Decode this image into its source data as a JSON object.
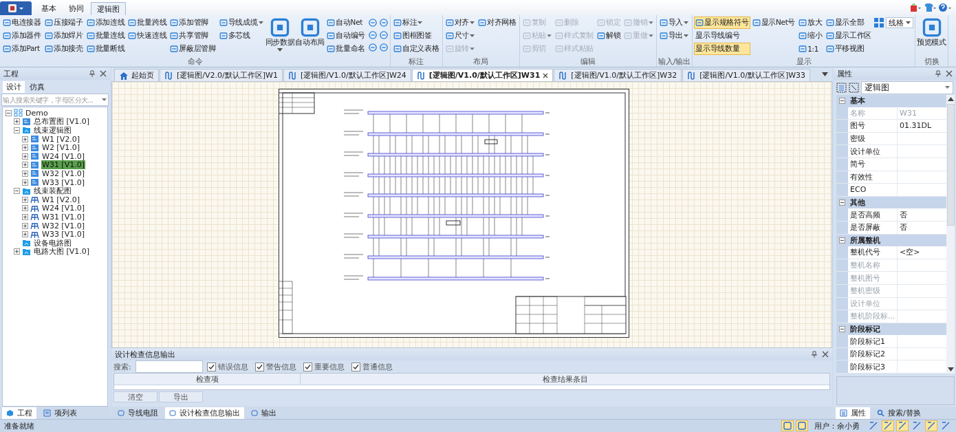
{
  "menu_tabs": [
    {
      "label": "基本",
      "selected": false
    },
    {
      "label": "协同",
      "selected": false
    },
    {
      "label": "逻辑图",
      "selected": true
    }
  ],
  "ribbon": [
    {
      "label": "命令",
      "columns": [
        {
          "kind": "small",
          "items": [
            {
              "label": "电连接器",
              "disabled": false,
              "dropdown": false
            },
            {
              "label": "添加器件",
              "disabled": false,
              "dropdown": false
            },
            {
              "label": "添加Part",
              "disabled": false,
              "dropdown": false
            }
          ]
        },
        {
          "kind": "small",
          "items": [
            {
              "label": "压接端子",
              "disabled": false,
              "dropdown": false
            },
            {
              "label": "添加焊片",
              "disabled": false,
              "dropdown": false
            },
            {
              "label": "添加接壳",
              "disabled": false,
              "dropdown": false
            }
          ]
        },
        {
          "kind": "small",
          "items": [
            {
              "label": "添加连线",
              "disabled": false,
              "dropdown": false
            },
            {
              "label": "批量连线",
              "disabled": false,
              "dropdown": false
            },
            {
              "label": "批量断线",
              "disabled": false,
              "dropdown": false
            }
          ]
        },
        {
          "kind": "small",
          "items": [
            {
              "label": "批量跨线",
              "disabled": false,
              "dropdown": false
            },
            {
              "label": "快速连线",
              "disabled": false,
              "dropdown": false
            }
          ]
        },
        {
          "kind": "small",
          "items": [
            {
              "label": "添加管脚",
              "disabled": false,
              "dropdown": false
            },
            {
              "label": "共享管脚",
              "disabled": false,
              "dropdown": false
            },
            {
              "label": "屏蔽层管脚",
              "disabled": false,
              "dropdown": false
            }
          ]
        },
        {
          "kind": "small",
          "items": [
            {
              "label": "导线成缆",
              "disabled": false,
              "dropdown": true
            },
            {
              "label": "多芯线",
              "disabled": false,
              "dropdown": false
            }
          ]
        },
        {
          "kind": "large",
          "items": [
            {
              "label": "同步数据",
              "disabled": false,
              "dropdown": true
            }
          ]
        },
        {
          "kind": "large",
          "items": [
            {
              "label": "自动布局",
              "disabled": false,
              "dropdown": false
            }
          ]
        },
        {
          "kind": "small",
          "items": [
            {
              "label": "自动Net",
              "disabled": false,
              "dropdown": false
            },
            {
              "label": "自动编号",
              "disabled": false,
              "dropdown": false
            },
            {
              "label": "批量命名",
              "disabled": false,
              "dropdown": false
            }
          ]
        },
        {
          "kind": "icons",
          "items": [
            {
              "disabled": false,
              "dropdown": false
            },
            {
              "disabled": false,
              "dropdown": false
            },
            {
              "disabled": false,
              "dropdown": false
            }
          ]
        },
        {
          "kind": "icons",
          "items": [
            {
              "disabled": false,
              "dropdown": false
            },
            {
              "disabled": false,
              "dropdown": false
            },
            {
              "disabled": false,
              "dropdown": false
            }
          ]
        }
      ]
    },
    {
      "label": "标注",
      "columns": [
        {
          "kind": "small",
          "items": [
            {
              "label": "标注",
              "disabled": false,
              "dropdown": true
            },
            {
              "label": "图框图签",
              "disabled": false,
              "dropdown": false
            },
            {
              "label": "自定义表格",
              "disabled": false,
              "dropdown": false
            }
          ]
        }
      ]
    },
    {
      "label": "布局",
      "columns": [
        {
          "kind": "small",
          "items": [
            {
              "label": "对齐",
              "disabled": false,
              "dropdown": true
            },
            {
              "label": "尺寸",
              "disabled": false,
              "dropdown": true
            },
            {
              "label": "旋转",
              "disabled": true,
              "dropdown": true
            }
          ]
        },
        {
          "kind": "small",
          "items": [
            {
              "label": "对齐网格",
              "disabled": false,
              "dropdown": false
            }
          ]
        }
      ]
    },
    {
      "label": "编辑",
      "columns": [
        {
          "kind": "small",
          "items": [
            {
              "label": "复制",
              "disabled": true,
              "dropdown": false
            },
            {
              "label": "粘贴",
              "disabled": true,
              "dropdown": true
            },
            {
              "label": "剪切",
              "disabled": true,
              "dropdown": false
            }
          ]
        },
        {
          "kind": "small",
          "items": [
            {
              "label": "删除",
              "disabled": true,
              "dropdown": false
            },
            {
              "label": "样式复制",
              "disabled": true,
              "dropdown": false
            },
            {
              "label": "样式粘贴",
              "disabled": true,
              "dropdown": false
            }
          ]
        },
        {
          "kind": "small",
          "items": [
            {
              "label": "锁定",
              "disabled": true,
              "dropdown": false
            },
            {
              "label": "解锁",
              "disabled": false,
              "dropdown": false
            }
          ]
        },
        {
          "kind": "small",
          "items": [
            {
              "label": "撤销",
              "disabled": true,
              "dropdown": true
            },
            {
              "label": "重做",
              "disabled": true,
              "dropdown": true
            }
          ]
        }
      ]
    },
    {
      "label": "输入/输出",
      "columns": [
        {
          "kind": "small",
          "items": [
            {
              "label": "导入",
              "disabled": false,
              "dropdown": true
            },
            {
              "label": "导出",
              "disabled": false,
              "dropdown": true
            }
          ]
        }
      ]
    },
    {
      "label": "显示",
      "columns": [
        {
          "kind": "toggles",
          "items": [
            {
              "label": "显示规格符号",
              "disabled": false,
              "dropdown": false,
              "selected": true
            },
            {
              "label": "显示导线编号",
              "disabled": false,
              "dropdown": false,
              "selected": false
            },
            {
              "label": "显示导线数量",
              "disabled": false,
              "dropdown": false,
              "selected": true
            }
          ]
        },
        {
          "kind": "toggles",
          "items": [
            {
              "label": "显示Net号",
              "disabled": false,
              "dropdown": false,
              "selected": false
            }
          ]
        },
        {
          "kind": "small",
          "items": [
            {
              "label": "放大",
              "disabled": false,
              "dropdown": false
            },
            {
              "label": "缩小",
              "disabled": false,
              "dropdown": false
            },
            {
              "label": "1:1",
              "disabled": false,
              "dropdown": false
            }
          ]
        },
        {
          "kind": "small",
          "items": [
            {
              "label": "显示全部",
              "disabled": false,
              "dropdown": false
            },
            {
              "label": "显示工作区",
              "disabled": false,
              "dropdown": false
            },
            {
              "label": "平移视图",
              "disabled": false,
              "dropdown": false
            }
          ]
        },
        {
          "kind": "select",
          "items": [
            {
              "label": "线格",
              "disabled": false,
              "dropdown": true
            }
          ]
        }
      ]
    },
    {
      "label": "切换",
      "columns": [
        {
          "kind": "large",
          "items": [
            {
              "label": "预览模式",
              "disabled": false,
              "dropdown": false
            }
          ]
        }
      ]
    }
  ],
  "project_panel": {
    "title": "工程",
    "tabs": [
      {
        "label": "设计",
        "selected": true
      },
      {
        "label": "仿真",
        "selected": false
      }
    ],
    "search": {
      "placeholder": "输入搜索关键字，字母区分大..."
    },
    "tree": [
      {
        "label": "Demo",
        "kind": "project",
        "expanded": true,
        "selected": false,
        "children": [
          {
            "label": "总布置图 [V1.0]",
            "kind": "diagram",
            "expanded": false,
            "selected": false
          },
          {
            "label": "线束逻辑图",
            "kind": "folder",
            "expanded": true,
            "selected": false,
            "children": [
              {
                "label": "W1 [V2.0]",
                "kind": "diagram",
                "expanded": false,
                "selected": false
              },
              {
                "label": "W2 [V1.0]",
                "kind": "diagram",
                "expanded": false,
                "selected": false
              },
              {
                "label": "W24 [V1.0]",
                "kind": "diagram",
                "expanded": false,
                "selected": false
              },
              {
                "label": "W31 [V1.0]",
                "kind": "diagram",
                "expanded": false,
                "selected": true
              },
              {
                "label": "W32 [V1.0]",
                "kind": "diagram",
                "expanded": false,
                "selected": false
              },
              {
                "label": "W33 [V1.0]",
                "kind": "diagram",
                "expanded": false,
                "selected": false
              }
            ]
          },
          {
            "label": "线束装配图",
            "kind": "folder",
            "expanded": true,
            "selected": false,
            "children": [
              {
                "label": "W1 [V2.0]",
                "kind": "assembly",
                "expanded": false,
                "selected": false
              },
              {
                "label": "W24 [V1.0]",
                "kind": "assembly",
                "expanded": false,
                "selected": false
              },
              {
                "label": "W31 [V1.0]",
                "kind": "assembly",
                "expanded": false,
                "selected": false
              },
              {
                "label": "W32 [V1.0]",
                "kind": "assembly",
                "expanded": false,
                "selected": false
              },
              {
                "label": "W33 [V1.0]",
                "kind": "assembly",
                "expanded": false,
                "selected": false
              }
            ]
          },
          {
            "label": "设备电路图",
            "kind": "folder",
            "selected": false
          },
          {
            "label": "电路大图 [V1.0]",
            "kind": "folder",
            "expanded": false,
            "selected": false
          }
        ]
      }
    ],
    "bottom_tabs": [
      {
        "label": "工程",
        "selected": true
      },
      {
        "label": "项列表",
        "selected": false
      }
    ]
  },
  "document_tabs": [
    {
      "label": "起始页",
      "kind": "home",
      "selected": false
    },
    {
      "label": "[逻辑图/V2.0/默认工作区]W1",
      "kind": "diagram",
      "selected": false
    },
    {
      "label": "[逻辑图/V1.0/默认工作区]W24",
      "kind": "diagram",
      "selected": false
    },
    {
      "label": "[逻辑图/V1.0/默认工作区]W31",
      "kind": "diagram",
      "selected": true
    },
    {
      "label": "[逻辑图/V1.0/默认工作区]W32",
      "kind": "diagram",
      "selected": false
    },
    {
      "label": "[逻辑图/V1.0/默认工作区]W33",
      "kind": "diagram",
      "selected": false
    }
  ],
  "check_panel": {
    "title": "设计检查信息输出",
    "search_label": "搜索:",
    "filters": [
      {
        "label": "错误信息",
        "checked": true
      },
      {
        "label": "警告信息",
        "checked": true
      },
      {
        "label": "重要信息",
        "checked": true
      },
      {
        "label": "普通信息",
        "checked": true
      }
    ],
    "columns": [
      "检查项",
      "检查结果条目"
    ],
    "buttons": [
      "清空",
      "导出"
    ]
  },
  "output_tabs": [
    {
      "label": "导线电阻",
      "selected": false
    },
    {
      "label": "设计检查信息输出",
      "selected": true
    },
    {
      "label": "输出",
      "selected": false
    }
  ],
  "properties_panel": {
    "title": "属性",
    "type": "逻辑图",
    "categories": [
      {
        "label": "基本",
        "expanded": true,
        "rows": [
          {
            "name": "名称",
            "value": "W31",
            "disabled": true
          },
          {
            "name": "图号",
            "value": "01.31DL",
            "disabled": false
          },
          {
            "name": "密级",
            "disabled": false
          },
          {
            "name": "设计单位",
            "disabled": false
          },
          {
            "name": "简号",
            "disabled": false
          },
          {
            "name": "有效性",
            "disabled": false
          },
          {
            "name": "ECO",
            "disabled": false
          }
        ]
      },
      {
        "label": "其他",
        "expanded": true,
        "rows": [
          {
            "name": "是否高频",
            "value": "否",
            "disabled": false
          },
          {
            "name": "是否屏蔽",
            "value": "否",
            "disabled": false
          }
        ]
      },
      {
        "label": "所属整机",
        "expanded": true,
        "rows": [
          {
            "name": "整机代号",
            "value": "<空>",
            "disabled": false
          },
          {
            "name": "整机名称",
            "disabled": true
          },
          {
            "name": "整机图号",
            "disabled": true
          },
          {
            "name": "整机密级",
            "disabled": true
          },
          {
            "name": "设计单位",
            "disabled": true
          },
          {
            "name": "整机阶段标...",
            "disabled": true
          }
        ]
      },
      {
        "label": "阶段标记",
        "expanded": true,
        "rows": [
          {
            "name": "阶段标记1",
            "disabled": false
          },
          {
            "name": "阶段标记2",
            "disabled": false
          },
          {
            "name": "阶段标记3",
            "disabled": false
          }
        ]
      }
    ],
    "bottom_tabs": [
      {
        "label": "属性",
        "selected": true
      },
      {
        "label": "搜索/替换",
        "selected": false
      }
    ]
  },
  "status_bar": {
    "text": "准备就绪",
    "left_tools": [
      {
        "selected": true
      },
      {
        "selected": true
      }
    ],
    "user": "用户：余小勇",
    "right_tools": [
      {
        "selected": false
      },
      {
        "selected": true
      },
      {
        "selected": true
      },
      {
        "selected": false
      },
      {
        "selected": true
      },
      {
        "selected": false
      }
    ]
  }
}
